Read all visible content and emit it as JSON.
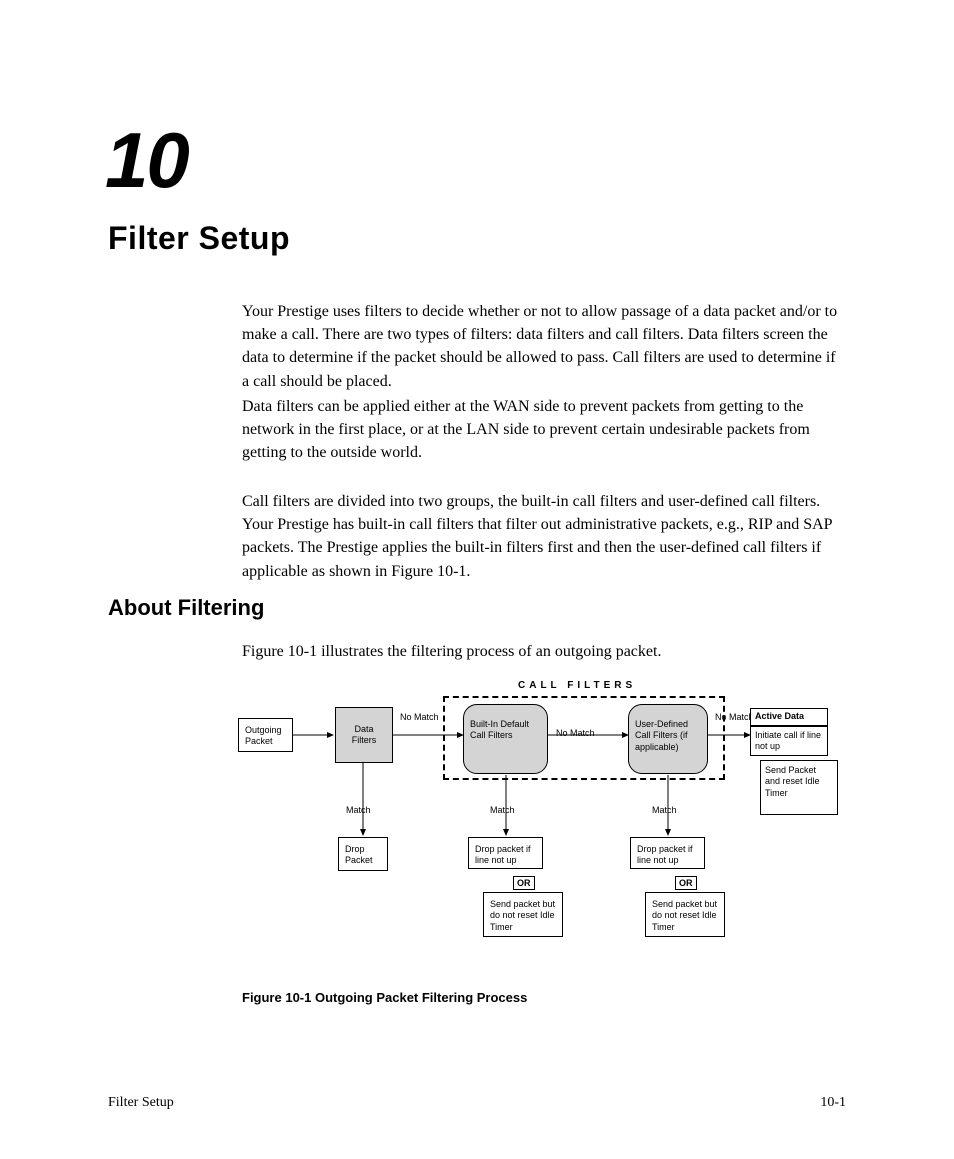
{
  "chapter": {
    "number": "10",
    "title": "Filter Setup"
  },
  "paragraphs": {
    "p1": "Your Prestige uses filters to decide whether or not to allow passage of a data packet and/or to make a call. There are two types of filters: data filters and call filters. Data filters screen the data to determine if the packet should be allowed to pass. Call filters are used to determine if a call should be placed.",
    "p2": "Data filters can be applied either at the WAN side to prevent packets from getting to the network in the first place, or at the LAN side to prevent certain undesirable packets from getting to the outside world.",
    "p3": "Call filters are divided into two groups, the built-in call filters and user-defined call filters. Your Prestige has built-in call filters that filter out administrative packets, e.g., RIP and SAP packets. The Prestige applies the built-in filters first and then the user-defined call filters if applicable as shown in Figure 10-1.",
    "p4": "Figure 10-1 illustrates the filtering process of an outgoing packet."
  },
  "section": {
    "title": "About Filtering"
  },
  "diagram": {
    "outgoing": "Outgoing\nPacket",
    "dataFilters": "Data\nFilters",
    "noMatch": "No\nMatch",
    "noMatchInline": "No Match",
    "match": "Match",
    "dropPacket": "Drop\nPacket",
    "callFiltersHeader": "CALL FILTERS",
    "builtin": "Built-In\nDefault\nCall Filters",
    "userDefined": "User-Defined\nCall Filters\n(if applicable)",
    "dropIfNotUp": "Drop packet\nif line not up",
    "sendNoReset": "Send packet\nbut do not\nreset Idle Timer",
    "or": "OR",
    "activeData": "Active Data",
    "initiateCall": "Initiate call\nif line not up",
    "sendReset": "Send Packet\nand reset\nIdle Timer"
  },
  "figure": {
    "caption": "Figure 10-1   Outgoing Packet Filtering Process"
  },
  "footer": {
    "left": "Filter Setup",
    "right": "10-1"
  }
}
